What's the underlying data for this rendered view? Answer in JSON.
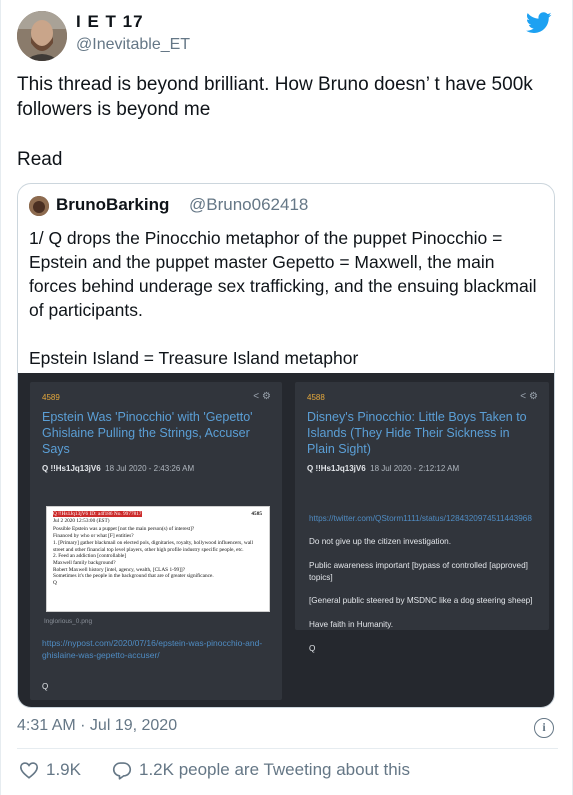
{
  "author": {
    "name": "I E T 17",
    "handle": "@Inevitable_ET"
  },
  "tweet": {
    "text": "This thread is beyond brilliant. How Bruno doesn’ t have 500k followers is beyond me\n\nRead"
  },
  "quoted": {
    "name": "BrunoBarking",
    "handle": "@Bruno062418",
    "text": "1/ Q drops the Pinocchio metaphor of the puppet Pinocchio = Epstein and the puppet master Gepetto = Maxwell,  the main forces behind underage sex trafficking, and the ensuing blackmail of participants.\n\nEpstein Island = Treasure Island metaphor",
    "media": {
      "left": {
        "number": "4589",
        "title": "Epstein Was 'Pinocchio' with 'Gepetto' Ghislaine Pulling the Strings, Accuser Says",
        "meta_id": "Q !!Hs1Jq13jV6",
        "meta_date": "18 Jul 2020 - 2:43:26 AM",
        "doc_header": "Q !!Hs1Jq13jV6  ID: a4f186  No. 9977817",
        "doc_date": "Jul 2 2020 12:53:00 (EST)",
        "doc_num": "4585",
        "doc_text": "Possible Epstein was a puppet [not the main person(s) of interest]?\nFinanced by who or what [F] entities?\n1. [Primary] gather blackmail on elected pols, dignitaries, royalty, hollywood influencers, wall street and other financial top level players, other high profile industry specific people, etc.\n2. Feed an addiction [controllable]\nMaxwell family background?\nRobert Maxwell history [intel, agency, wealth, [CLAS 1-99]]?\nSometimes it's the people in the background that are of greater significance.\nQ",
        "filename": "Inglorious_0.png",
        "link": "https://nypost.com/2020/07/16/epstein-was-pinocchio-and-ghislaine-was-gepetto-accuser/",
        "sig": "Q"
      },
      "right": {
        "number": "4588",
        "title": "Disney's Pinocchio: Little Boys Taken to Islands (They Hide Their Sickness in Plain Sight)",
        "meta_id": "Q !!Hs1Jq13jV6",
        "meta_date": "18 Jul 2020 - 2:12:12 AM",
        "link": "https://twitter.com/QStorm1111/status/1284320974511443968",
        "lines": [
          "Do not give up the citizen investigation.",
          "Public awareness important [bypass of controlled [approved] topics]",
          "[General public steered by MSDNC like a dog steering sheep]",
          "Have faith in Humanity.",
          "Q"
        ]
      }
    }
  },
  "footer": {
    "timestamp": "4:31 AM · Jul 19, 2020",
    "likes": "1.9K",
    "replies_text": "1.2K people are Tweeting about this"
  },
  "colors": {
    "twitter_blue": "#1da1f2",
    "link": "#5b9fd6",
    "q_number": "#e6a93c"
  }
}
